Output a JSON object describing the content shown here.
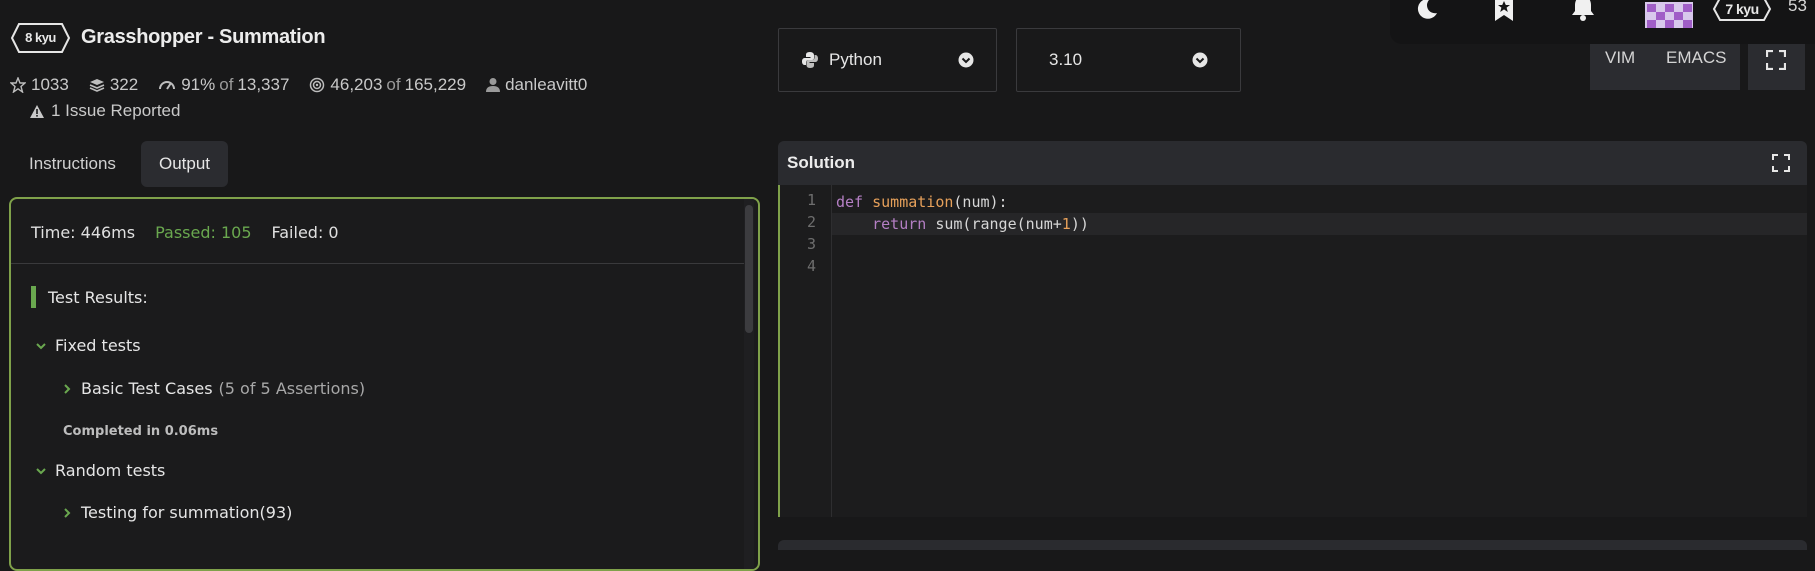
{
  "kata": {
    "rank": "8 kyu",
    "title": "Grasshopper - Summation",
    "stars": "1033",
    "collections": "322",
    "satisfaction_pct": "91%",
    "of_word": "of",
    "satisfaction_votes": "13,337",
    "completed": "46,203",
    "attempted": "165,229",
    "author": "danleavitt0",
    "issues": "1 Issue Reported"
  },
  "tabs": {
    "instructions": "Instructions",
    "output": "Output"
  },
  "output": {
    "time": "Time: 446ms",
    "passed": "Passed: 105",
    "failed": "Failed: 0",
    "results_heading": "Test Results:",
    "groups": [
      {
        "label": "Fixed tests",
        "items": [
          {
            "label": "Basic Test Cases",
            "count": "(5 of 5 Assertions)"
          }
        ],
        "completed": "Completed in 0.06ms"
      },
      {
        "label": "Random tests",
        "items": [
          {
            "label": "Testing for summation(93)"
          }
        ]
      }
    ]
  },
  "selects": {
    "language": "Python",
    "version": "3.10"
  },
  "user": {
    "rank": "7 kyu",
    "honor": "53"
  },
  "editor_modes": {
    "vim": "VIM",
    "emacs": "EMACS"
  },
  "solution": {
    "title": "Solution",
    "line_numbers": [
      "1",
      "2",
      "3",
      "4"
    ],
    "code": {
      "l1_def": "def",
      "l1_fn": "summation",
      "l1_rest": "(num):",
      "l2_indent": "    ",
      "l2_return": "return",
      "l2_mid": " sum(range(num+",
      "l2_num": "1",
      "l2_end": "))"
    }
  },
  "colors": {
    "accent_green": "#7fa14a",
    "passed_green": "#6aa84f",
    "background": "#181819",
    "keyword": "#b47fc4",
    "function": "#e6a05a"
  },
  "icons": [
    "star-icon",
    "collection-icon",
    "satisfaction-icon",
    "target-icon",
    "user-icon",
    "warning-icon",
    "python-icon",
    "chevron-down-icon",
    "moon-icon",
    "bookmark-icon",
    "bell-icon",
    "fullscreen-icon",
    "expand-icon"
  ]
}
